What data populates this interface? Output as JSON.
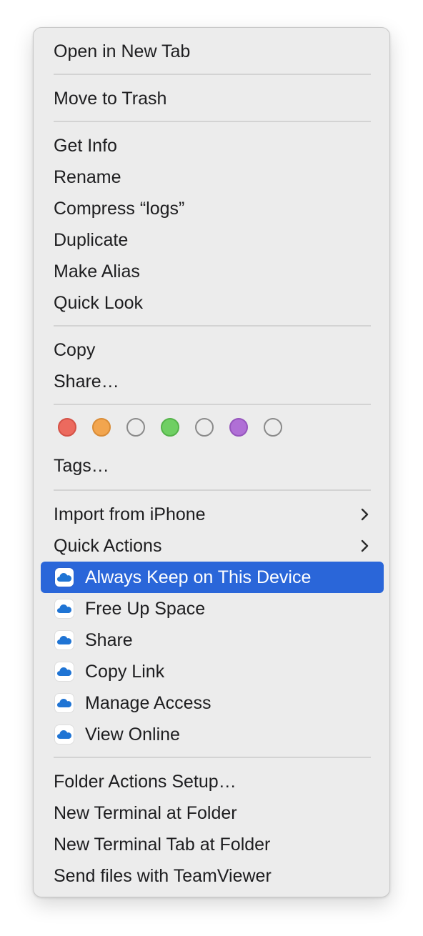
{
  "menu": {
    "groups": [
      {
        "items": [
          {
            "label": "Open in New Tab"
          }
        ]
      },
      {
        "items": [
          {
            "label": "Move to Trash"
          }
        ]
      },
      {
        "items": [
          {
            "label": "Get Info"
          },
          {
            "label": "Rename"
          },
          {
            "label": "Compress “logs”"
          },
          {
            "label": "Duplicate"
          },
          {
            "label": "Make Alias"
          },
          {
            "label": "Quick Look"
          }
        ]
      },
      {
        "items": [
          {
            "label": "Copy"
          },
          {
            "label": "Share…"
          }
        ]
      }
    ],
    "tags": {
      "colors": [
        {
          "name": "red",
          "fill": "#ec6a5e",
          "stroke": "#d45247"
        },
        {
          "name": "orange",
          "fill": "#f2a54e",
          "stroke": "#d98c37"
        },
        {
          "name": "none",
          "fill": "transparent",
          "stroke": "#8a8a8a"
        },
        {
          "name": "green",
          "fill": "#6fcf63",
          "stroke": "#55b34a"
        },
        {
          "name": "none",
          "fill": "transparent",
          "stroke": "#8a8a8a"
        },
        {
          "name": "purple",
          "fill": "#b06fd6",
          "stroke": "#9656bd"
        },
        {
          "name": "none",
          "fill": "transparent",
          "stroke": "#8a8a8a"
        }
      ],
      "tags_label": "Tags…"
    },
    "submenus": {
      "import_from_iphone": "Import from iPhone",
      "quick_actions": "Quick Actions"
    },
    "onedrive": {
      "icon": "onedrive-cloud-icon",
      "items": [
        {
          "label": "Always Keep on This Device",
          "highlighted": true
        },
        {
          "label": "Free Up Space"
        },
        {
          "label": "Share"
        },
        {
          "label": "Copy Link"
        },
        {
          "label": "Manage Access"
        },
        {
          "label": "View Online"
        }
      ]
    },
    "services": {
      "items": [
        {
          "label": "Folder Actions Setup…"
        },
        {
          "label": "New Terminal at Folder"
        },
        {
          "label": "New Terminal Tab at Folder"
        },
        {
          "label": "Send files with TeamViewer"
        }
      ]
    }
  },
  "colors": {
    "highlight": "#2a66d9",
    "menu_background": "#ececec",
    "text": "#1d1d1f"
  }
}
